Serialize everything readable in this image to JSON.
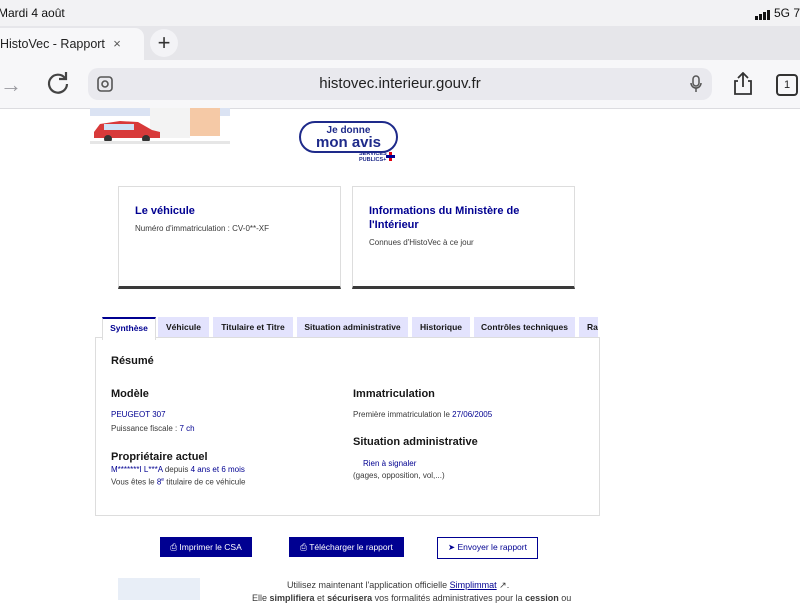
{
  "status_bar": {
    "time": "Mardi 4 août",
    "network": "5G",
    "battery": "7"
  },
  "browser": {
    "tab_title": "HistoVec - Rapport vendeur",
    "tab_close": "×",
    "new_tab": "+",
    "url": "histovec.interieur.gouv.fr",
    "tabs_count": "1"
  },
  "banner": {
    "avis_line1": "Je donne",
    "avis_line2": "mon avis",
    "services_publics_line1": "SERVICES",
    "services_publics_line2": "PUBLICS+"
  },
  "cards": {
    "vehicle": {
      "title": "Le véhicule",
      "text": "Numéro d'immatriculation : CV-0**-XF"
    },
    "ministry": {
      "title": "Informations du Ministère de l'Intérieur",
      "text": "Connues d'HistoVec à ce jour"
    }
  },
  "tabs": [
    {
      "label": "Synthèse"
    },
    {
      "label": "Véhicule"
    },
    {
      "label": "Titulaire et Titre"
    },
    {
      "label": "Situation administrative"
    },
    {
      "label": "Historique"
    },
    {
      "label": "Contrôles techniques"
    },
    {
      "label": "Rapport"
    }
  ],
  "summary": {
    "title": "Résumé",
    "model": {
      "heading": "Modèle",
      "name": "PEUGEOT 307",
      "power_label": "Puissance fiscale : ",
      "power_value": "7 ch"
    },
    "owner": {
      "heading": "Propriétaire actuel",
      "name": "M*******I L***A",
      "since_label": " depuis ",
      "duration": "4 ans et 6 mois",
      "rank_prefix": "Vous êtes le ",
      "rank_number": "8",
      "rank_sup": "e",
      "rank_suffix": " titulaire de ce véhicule"
    },
    "registration": {
      "heading": "Immatriculation",
      "first_label": "Première immatriculation le ",
      "first_date": "27/06/2005"
    },
    "admin": {
      "heading": "Situation administrative",
      "status": "Rien à signaler",
      "detail": "(gages, opposition, vol,...)"
    }
  },
  "actions": {
    "print": "Imprimer le CSA",
    "download": "Télécharger le rapport",
    "send": "Envoyer le rapport"
  },
  "footer": {
    "line1_prefix": "Utilisez maintenant l'application officielle ",
    "line1_link": "Simplimmat",
    "line1_suffix": ".",
    "line2_a": "Elle ",
    "line2_b": "simplifiera",
    "line2_c": " et ",
    "line2_d": "sécurisera",
    "line2_e": " vos formalités administratives pour la ",
    "line2_f": "cession",
    "line2_g": " ou"
  },
  "colors": {
    "brand_blue": "#000091",
    "tab_bg": "#e3e3fd"
  }
}
